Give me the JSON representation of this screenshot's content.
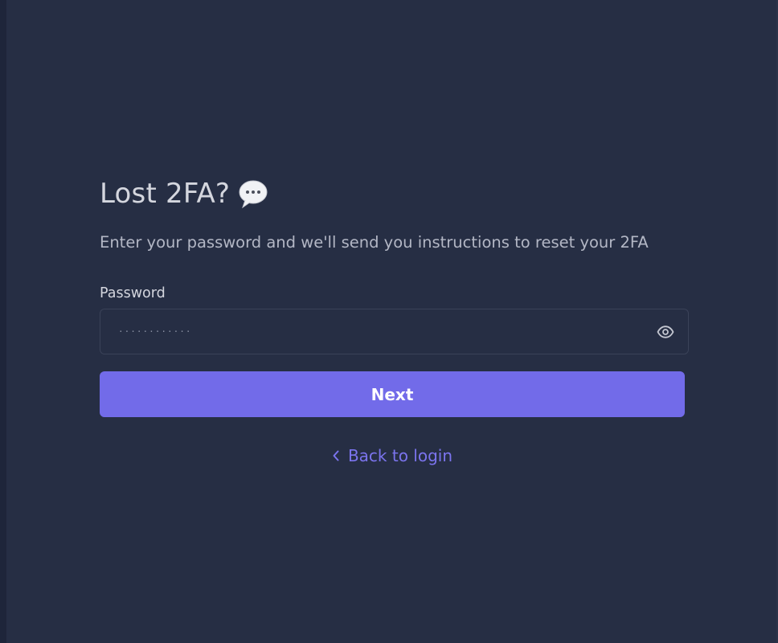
{
  "header": {
    "title": "Lost 2FA?",
    "title_icon": "speech-bubble-icon",
    "subtitle": "Enter your password and we'll send you instructions to reset your 2FA"
  },
  "form": {
    "password_label": "Password",
    "password_value": "············",
    "toggle_icon": "eye-icon"
  },
  "actions": {
    "next_label": "Next",
    "back_label": "Back to login",
    "back_icon": "chevron-left-icon"
  },
  "colors": {
    "background": "#262e44",
    "accent": "#726be9",
    "link": "#7b74ee",
    "text_primary": "#d4d6de",
    "text_secondary": "#b3b7c5"
  }
}
